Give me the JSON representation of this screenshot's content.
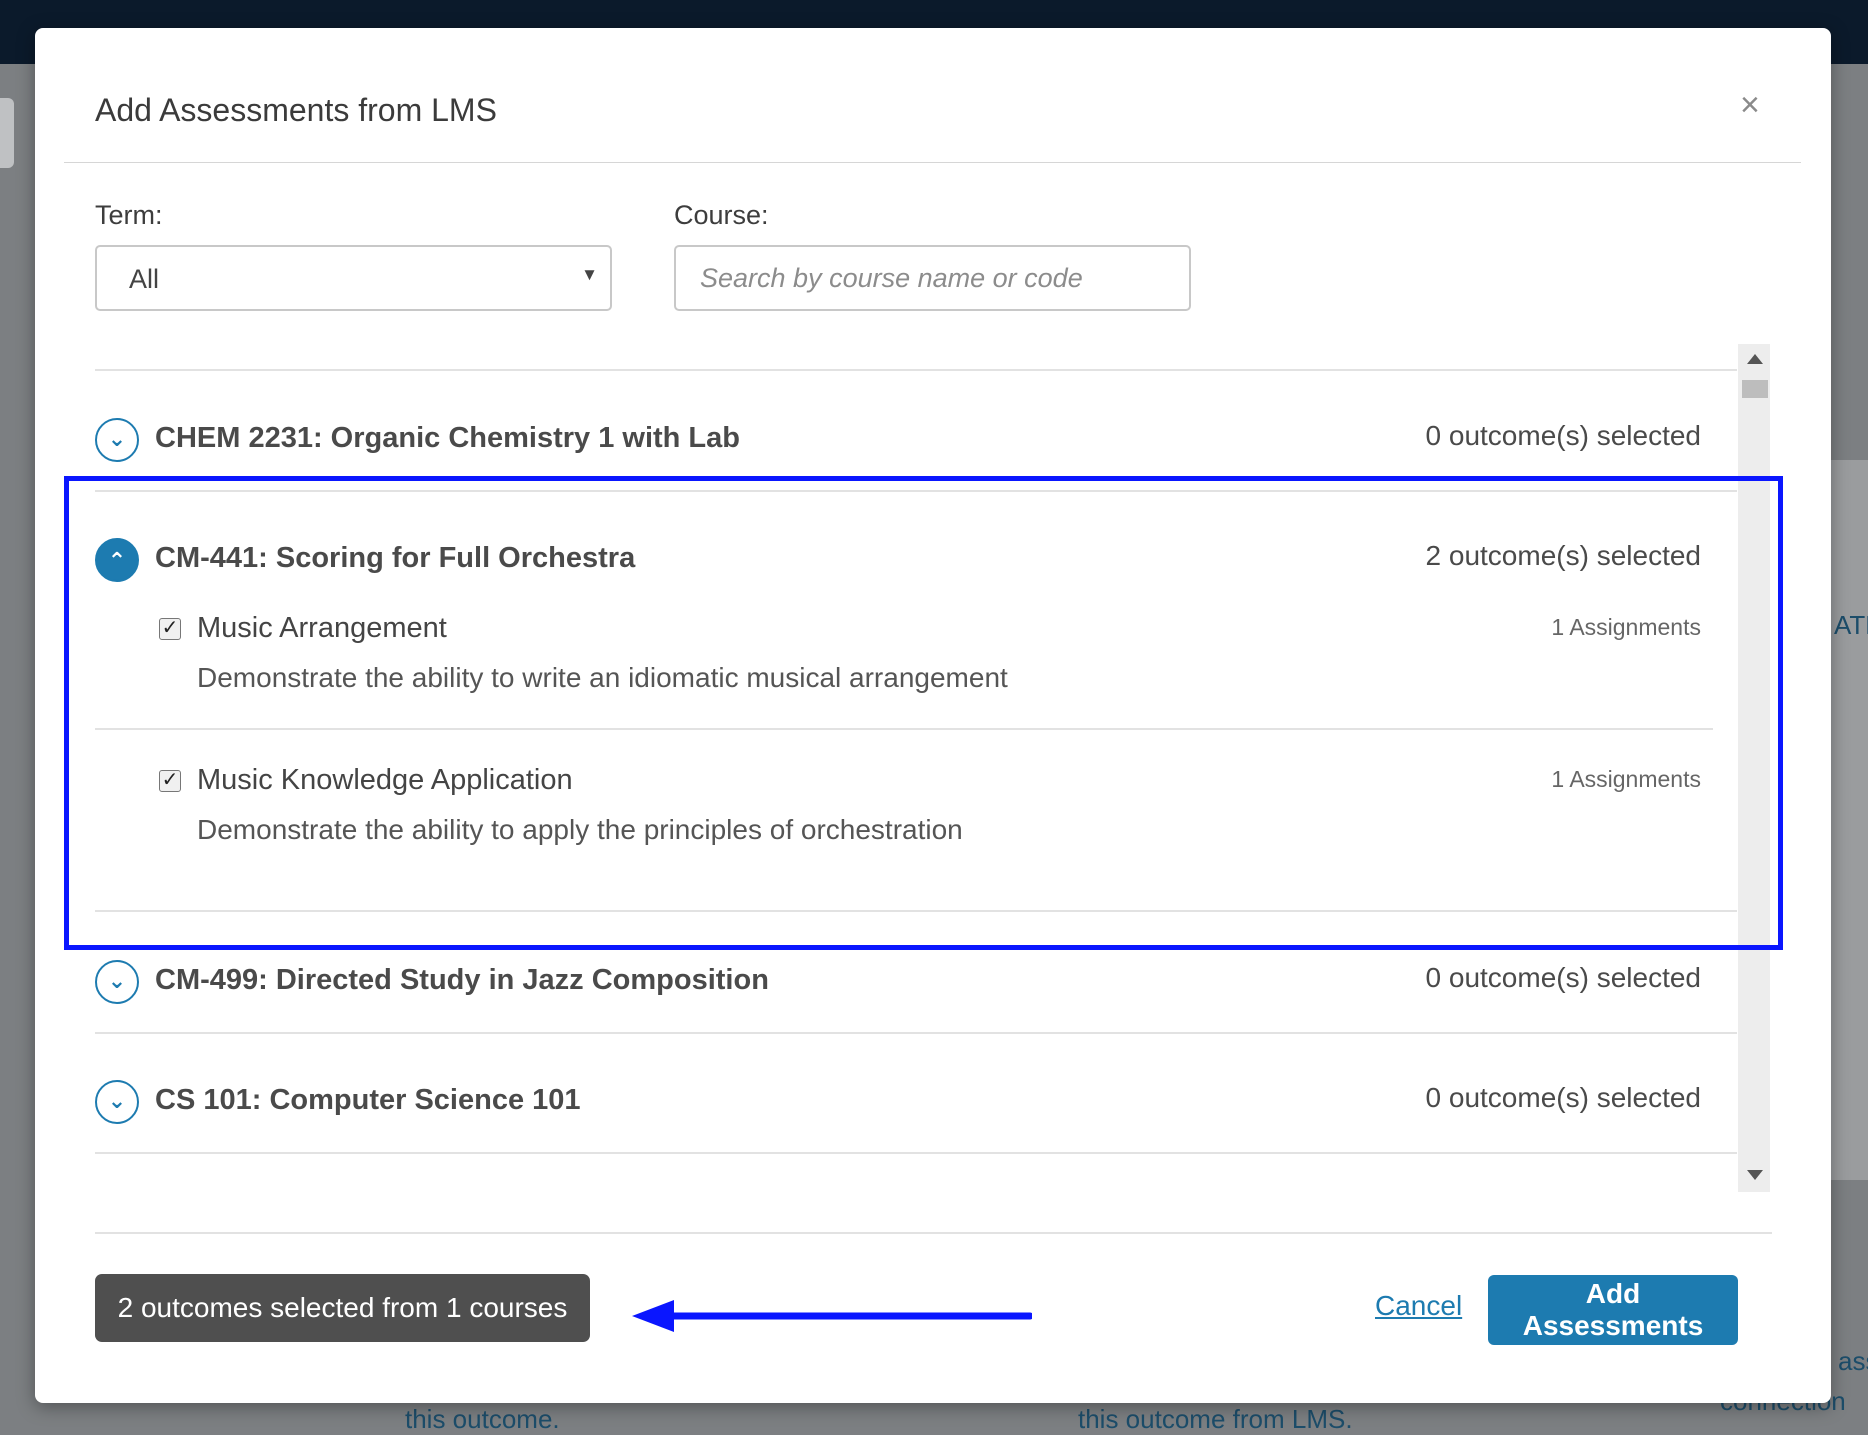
{
  "modal": {
    "title": "Add Assessments from LMS",
    "close_glyph": "×"
  },
  "filters": {
    "term_label": "Term:",
    "term_value": "All",
    "course_label": "Course:",
    "course_placeholder": "Search by course name or code"
  },
  "courses": [
    {
      "name": "CHEM 2231: Organic Chemistry 1 with Lab",
      "selected_text": "0 outcome(s) selected",
      "expanded": false
    },
    {
      "name": "CM-441: Scoring for Full Orchestra",
      "selected_text": "2 outcome(s) selected",
      "expanded": true,
      "outcomes": [
        {
          "title": "Music Arrangement",
          "description": "Demonstrate the ability to write an idiomatic musical arrangement",
          "assignments": "1 Assignments",
          "checked": true
        },
        {
          "title": "Music Knowledge Application",
          "description": "Demonstrate the ability to apply the principles of orchestration",
          "assignments": "1 Assignments",
          "checked": true
        }
      ]
    },
    {
      "name": "CM-499: Directed Study in Jazz Composition",
      "selected_text": "0 outcome(s) selected",
      "expanded": false
    },
    {
      "name": "CS 101: Computer Science 101",
      "selected_text": "0 outcome(s) selected",
      "expanded": false
    }
  ],
  "footer": {
    "summary": "2 outcomes selected from 1 courses",
    "cancel_label": "Cancel",
    "add_label": "Add Assessments"
  },
  "background": {
    "fragments": [
      "ATE",
      "this outcome.",
      "this outcome from LMS.",
      "ass",
      "connection"
    ]
  },
  "colors": {
    "accent": "#1d7bb0",
    "annotation": "#0a16ff",
    "badge": "#4f4f4f"
  }
}
